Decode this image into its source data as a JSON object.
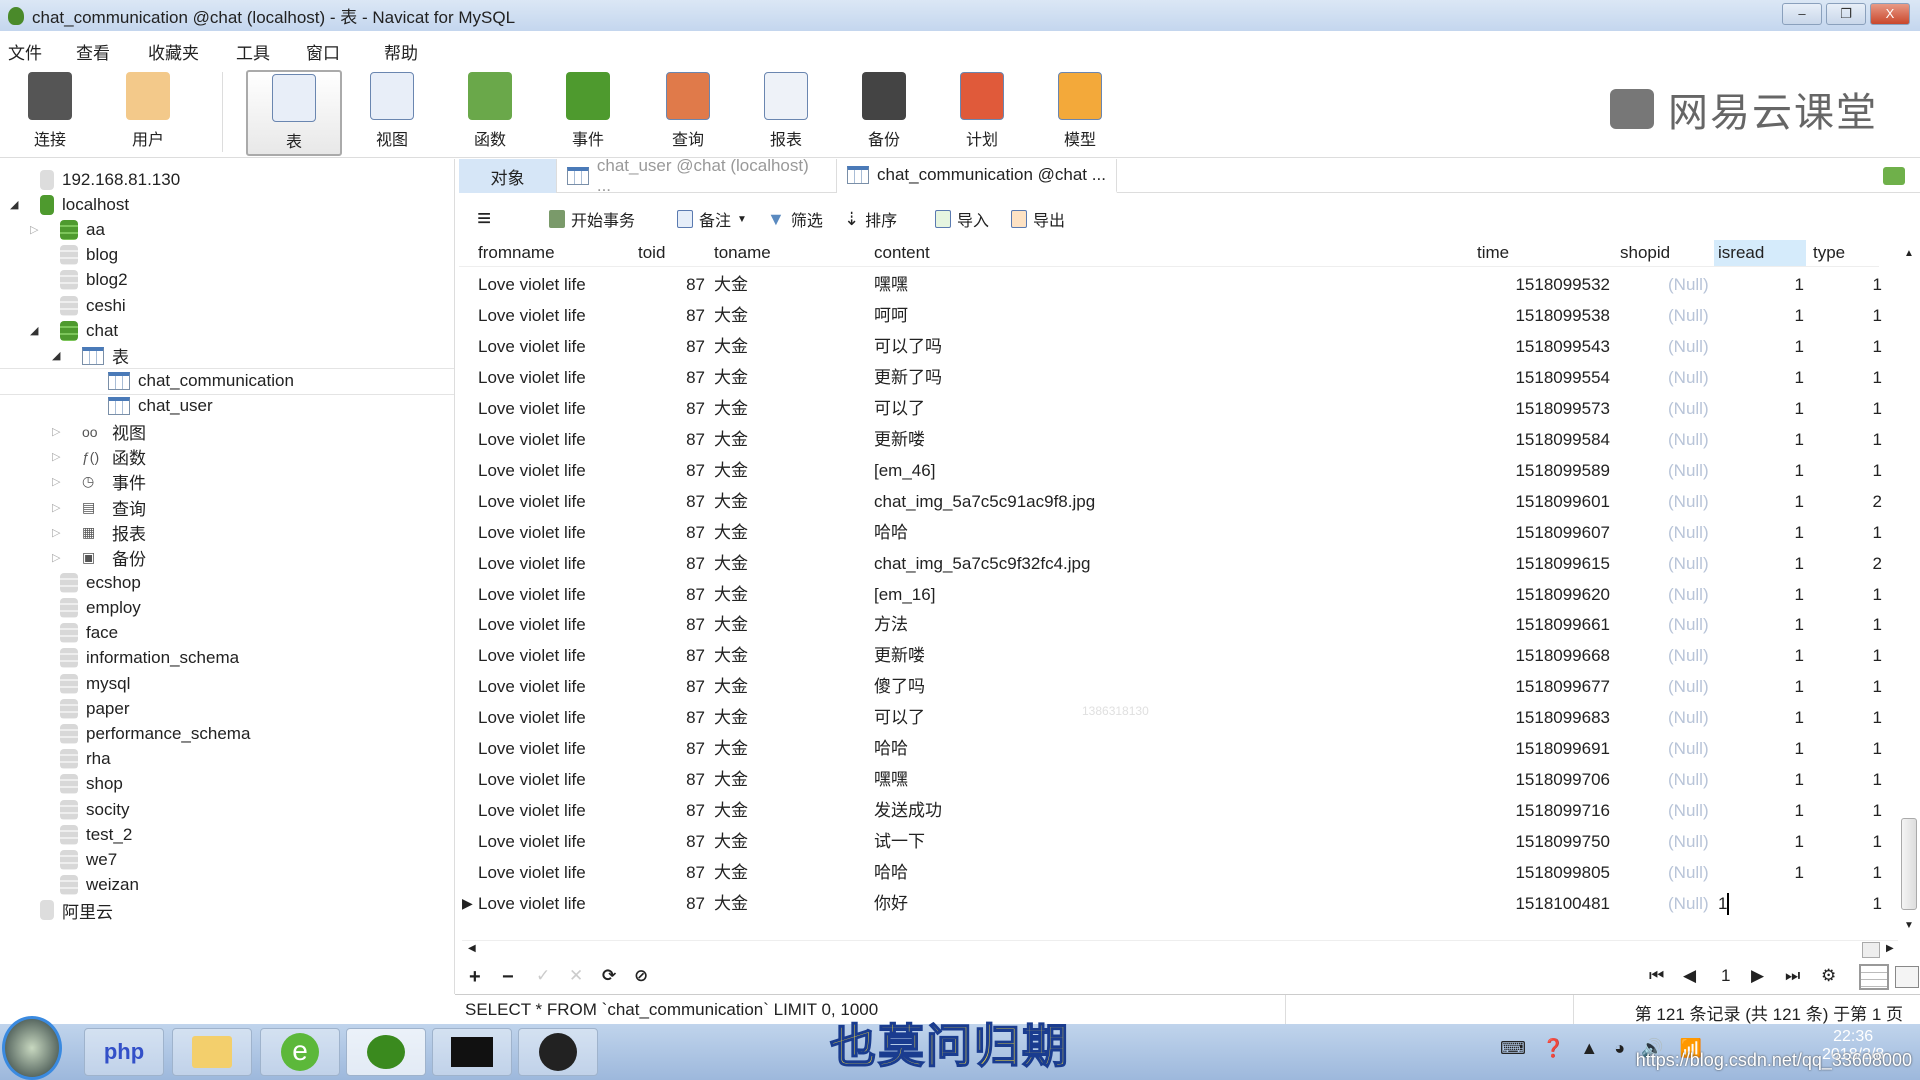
{
  "window": {
    "title": "chat_communication @chat (localhost) - 表 - Navicat for MySQL",
    "minimize": "–",
    "maximize": "❐",
    "close": "X"
  },
  "menu": [
    "文件",
    "查看",
    "收藏夹",
    "工具",
    "窗口",
    "帮助"
  ],
  "toolbar": [
    "连接",
    "用户",
    "表",
    "视图",
    "函数",
    "事件",
    "查询",
    "报表",
    "备份",
    "计划",
    "模型"
  ],
  "toolbar_active": "表",
  "logo_text": "网易云课堂",
  "sidebar": {
    "items": [
      {
        "label": "192.168.81.130",
        "level": 0,
        "kind": "conn-off"
      },
      {
        "label": "localhost",
        "level": 0,
        "kind": "conn-on",
        "expanded": true
      },
      {
        "label": "aa",
        "level": 1,
        "kind": "db-on",
        "collapsed": true
      },
      {
        "label": "blog",
        "level": 1,
        "kind": "db-off"
      },
      {
        "label": "blog2",
        "level": 1,
        "kind": "db-off"
      },
      {
        "label": "ceshi",
        "level": 1,
        "kind": "db-off"
      },
      {
        "label": "chat",
        "level": 1,
        "kind": "db-on",
        "expanded": true
      },
      {
        "label": "表",
        "level": 2,
        "kind": "tables",
        "expanded": true
      },
      {
        "label": "chat_communication",
        "level": 3,
        "kind": "table",
        "selected": true
      },
      {
        "label": "chat_user",
        "level": 3,
        "kind": "table"
      },
      {
        "label": "视图",
        "level": 2,
        "kind": "views",
        "collapsed": true
      },
      {
        "label": "函数",
        "level": 2,
        "kind": "functions",
        "collapsed": true
      },
      {
        "label": "事件",
        "level": 2,
        "kind": "events",
        "collapsed": true
      },
      {
        "label": "查询",
        "level": 2,
        "kind": "queries",
        "collapsed": true
      },
      {
        "label": "报表",
        "level": 2,
        "kind": "reports",
        "collapsed": true
      },
      {
        "label": "备份",
        "level": 2,
        "kind": "backups",
        "collapsed": true
      },
      {
        "label": "ecshop",
        "level": 1,
        "kind": "db-off"
      },
      {
        "label": "employ",
        "level": 1,
        "kind": "db-off"
      },
      {
        "label": "face",
        "level": 1,
        "kind": "db-off"
      },
      {
        "label": "information_schema",
        "level": 1,
        "kind": "db-off"
      },
      {
        "label": "mysql",
        "level": 1,
        "kind": "db-off"
      },
      {
        "label": "paper",
        "level": 1,
        "kind": "db-off"
      },
      {
        "label": "performance_schema",
        "level": 1,
        "kind": "db-off"
      },
      {
        "label": "rha",
        "level": 1,
        "kind": "db-off"
      },
      {
        "label": "shop",
        "level": 1,
        "kind": "db-off"
      },
      {
        "label": "socity",
        "level": 1,
        "kind": "db-off"
      },
      {
        "label": "test_2",
        "level": 1,
        "kind": "db-off"
      },
      {
        "label": "we7",
        "level": 1,
        "kind": "db-off"
      },
      {
        "label": "weizan",
        "level": 1,
        "kind": "db-off"
      },
      {
        "label": "阿里云",
        "level": 0,
        "kind": "conn-off"
      }
    ]
  },
  "tabs": {
    "objects": "对象",
    "tab1": "chat_user @chat (localhost) ...",
    "tab2": "chat_communication @chat ..."
  },
  "table_toolbar": {
    "begin_tx": "开始事务",
    "memo": "备注",
    "filter": "筛选",
    "sort": "排序",
    "import": "导入",
    "export": "导出"
  },
  "columns": [
    "fromname",
    "toid",
    "toname",
    "content",
    "time",
    "shopid",
    "isread",
    "type"
  ],
  "highlighted_column": "isread",
  "rows": [
    [
      "Love violet life",
      "87",
      "大金",
      "嘿嘿",
      "1518099532",
      "(Null)",
      "1",
      "1"
    ],
    [
      "Love violet life",
      "87",
      "大金",
      "呵呵",
      "1518099538",
      "(Null)",
      "1",
      "1"
    ],
    [
      "Love violet life",
      "87",
      "大金",
      "可以了吗",
      "1518099543",
      "(Null)",
      "1",
      "1"
    ],
    [
      "Love violet life",
      "87",
      "大金",
      "更新了吗",
      "1518099554",
      "(Null)",
      "1",
      "1"
    ],
    [
      "Love violet life",
      "87",
      "大金",
      "可以了",
      "1518099573",
      "(Null)",
      "1",
      "1"
    ],
    [
      "Love violet life",
      "87",
      "大金",
      "更新喽",
      "1518099584",
      "(Null)",
      "1",
      "1"
    ],
    [
      "Love violet life",
      "87",
      "大金",
      "[em_46]",
      "1518099589",
      "(Null)",
      "1",
      "1"
    ],
    [
      "Love violet life",
      "87",
      "大金",
      "chat_img_5a7c5c91ac9f8.jpg",
      "1518099601",
      "(Null)",
      "1",
      "2"
    ],
    [
      "Love violet life",
      "87",
      "大金",
      "哈哈",
      "1518099607",
      "(Null)",
      "1",
      "1"
    ],
    [
      "Love violet life",
      "87",
      "大金",
      "chat_img_5a7c5c9f32fc4.jpg",
      "1518099615",
      "(Null)",
      "1",
      "2"
    ],
    [
      "Love violet life",
      "87",
      "大金",
      "[em_16]",
      "1518099620",
      "(Null)",
      "1",
      "1"
    ],
    [
      "Love violet life",
      "87",
      "大金",
      "方法",
      "1518099661",
      "(Null)",
      "1",
      "1"
    ],
    [
      "Love violet life",
      "87",
      "大金",
      "更新喽",
      "1518099668",
      "(Null)",
      "1",
      "1"
    ],
    [
      "Love violet life",
      "87",
      "大金",
      "傻了吗",
      "1518099677",
      "(Null)",
      "1",
      "1"
    ],
    [
      "Love violet life",
      "87",
      "大金",
      "可以了",
      "1518099683",
      "(Null)",
      "1",
      "1"
    ],
    [
      "Love violet life",
      "87",
      "大金",
      "哈哈",
      "1518099691",
      "(Null)",
      "1",
      "1"
    ],
    [
      "Love violet life",
      "87",
      "大金",
      "嘿嘿",
      "1518099706",
      "(Null)",
      "1",
      "1"
    ],
    [
      "Love violet life",
      "87",
      "大金",
      "发送成功",
      "1518099716",
      "(Null)",
      "1",
      "1"
    ],
    [
      "Love violet life",
      "87",
      "大金",
      "试一下",
      "1518099750",
      "(Null)",
      "1",
      "1"
    ],
    [
      "Love violet life",
      "87",
      "大金",
      "哈哈",
      "1518099805",
      "(Null)",
      "1",
      "1"
    ],
    [
      "Love violet life",
      "87",
      "大金",
      "你好",
      "1518100481",
      "(Null)",
      "1",
      "1"
    ]
  ],
  "grid_watermark": "1386318130",
  "bottom": {
    "add": "+",
    "delete": "−",
    "apply": "✓",
    "discard": "✕",
    "refresh": "⟳",
    "stop": "⊘",
    "page": "1"
  },
  "status": {
    "sql": "SELECT * FROM `chat_communication` LIMIT 0, 1000",
    "records": "第 121 条记录 (共 121 条) 于第 1 页"
  },
  "taskbar": {
    "clock": "22:36",
    "date": "2018/2/8"
  },
  "subtitle": "也莫问归期",
  "watermark": "https://blog.csdn.net/qq_33608000"
}
